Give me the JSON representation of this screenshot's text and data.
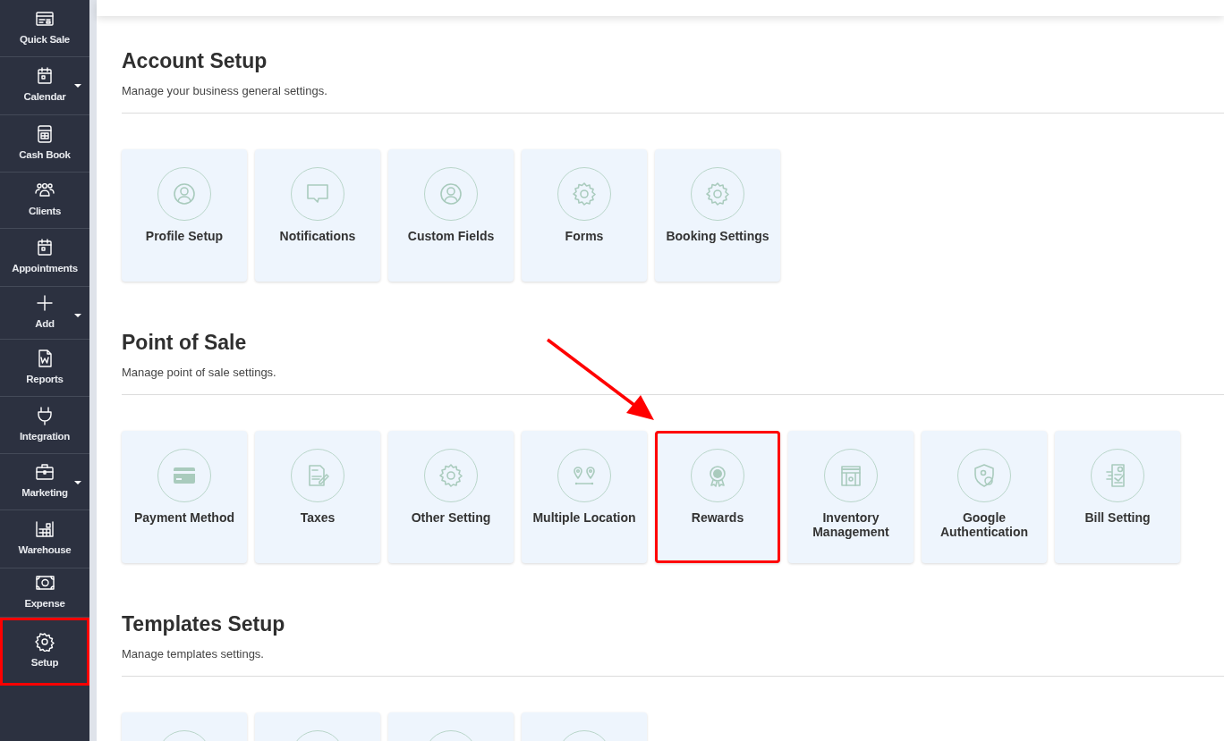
{
  "sidebar": {
    "items": [
      {
        "label": "Quick Sale",
        "has_dropdown": false,
        "highlighted": false
      },
      {
        "label": "Calendar",
        "has_dropdown": true,
        "highlighted": false
      },
      {
        "label": "Cash Book",
        "has_dropdown": false,
        "highlighted": false
      },
      {
        "label": "Clients",
        "has_dropdown": false,
        "highlighted": false
      },
      {
        "label": "Appointments",
        "has_dropdown": false,
        "highlighted": false
      },
      {
        "label": "Add",
        "has_dropdown": true,
        "highlighted": false
      },
      {
        "label": "Reports",
        "has_dropdown": false,
        "highlighted": false
      },
      {
        "label": "Integration",
        "has_dropdown": false,
        "highlighted": false
      },
      {
        "label": "Marketing",
        "has_dropdown": true,
        "highlighted": false
      },
      {
        "label": "Warehouse",
        "has_dropdown": false,
        "highlighted": false
      },
      {
        "label": "Expense",
        "has_dropdown": false,
        "highlighted": false
      },
      {
        "label": "Setup",
        "has_dropdown": false,
        "highlighted": true
      }
    ]
  },
  "sections": [
    {
      "title": "Account Setup",
      "subtitle": "Manage your business general settings.",
      "cards": [
        {
          "label": "Profile Setup",
          "highlighted": false
        },
        {
          "label": "Notifications",
          "highlighted": false
        },
        {
          "label": "Custom Fields",
          "highlighted": false
        },
        {
          "label": "Forms",
          "highlighted": false
        },
        {
          "label": "Booking Settings",
          "highlighted": false
        }
      ]
    },
    {
      "title": "Point of Sale",
      "subtitle": "Manage point of sale settings.",
      "cards": [
        {
          "label": "Payment Method",
          "highlighted": false
        },
        {
          "label": "Taxes",
          "highlighted": false
        },
        {
          "label": "Other Setting",
          "highlighted": false
        },
        {
          "label": "Multiple Location",
          "highlighted": false
        },
        {
          "label": "Rewards",
          "highlighted": true
        },
        {
          "label": "Inventory Management",
          "highlighted": false
        },
        {
          "label": "Google Authentication",
          "highlighted": false
        },
        {
          "label": "Bill Setting",
          "highlighted": false
        }
      ]
    },
    {
      "title": "Templates Setup",
      "subtitle": "Manage templates settings.",
      "cards": [
        {
          "highlighted": false
        },
        {
          "highlighted": false
        },
        {
          "highlighted": false
        },
        {
          "highlighted": false
        }
      ]
    }
  ],
  "annotation_arrow": true
}
